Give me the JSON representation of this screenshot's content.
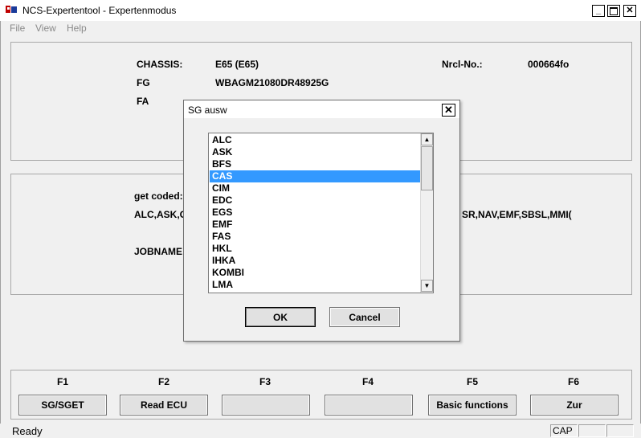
{
  "window": {
    "title": "NCS-Expertentool - Expertenmodus"
  },
  "menu": {
    "file": "File",
    "view": "View",
    "help": "Help"
  },
  "info": {
    "chassis_label": "CHASSIS:",
    "chassis_value": "E65 (E65)",
    "nrcl_label": "Nrcl-No.:",
    "nrcl_value": "000664fo",
    "fg_label": "FG",
    "fg_value": "WBAGM21080DR48925G",
    "fa_label": "FA"
  },
  "coding": {
    "get_coded_label": "get coded:",
    "modules_left": "ALC,ASK,C",
    "modules_right": "SR,NAV,EMF,SBSL,MMI(",
    "jobname_label": "JOBNAME"
  },
  "fkeys": {
    "labels": [
      "F1",
      "F2",
      "F3",
      "F4",
      "F5",
      "F6"
    ],
    "buttons": [
      "SG/SGET",
      "Read ECU",
      "",
      "",
      "Basic functions",
      "Zur"
    ]
  },
  "status": {
    "text": "Ready",
    "cap": "CAP"
  },
  "dialog": {
    "title": "SG ausw",
    "items": [
      "ALC",
      "ASK",
      "BFS",
      "CAS",
      "CIM",
      "EDC",
      "EGS",
      "EMF",
      "FAS",
      "HKL",
      "IHKA",
      "KOMBI",
      "LMA"
    ],
    "selected": "CAS",
    "ok": "OK",
    "cancel": "Cancel",
    "close_glyph": "✕"
  },
  "colors": {
    "selection": "#3399ff"
  }
}
